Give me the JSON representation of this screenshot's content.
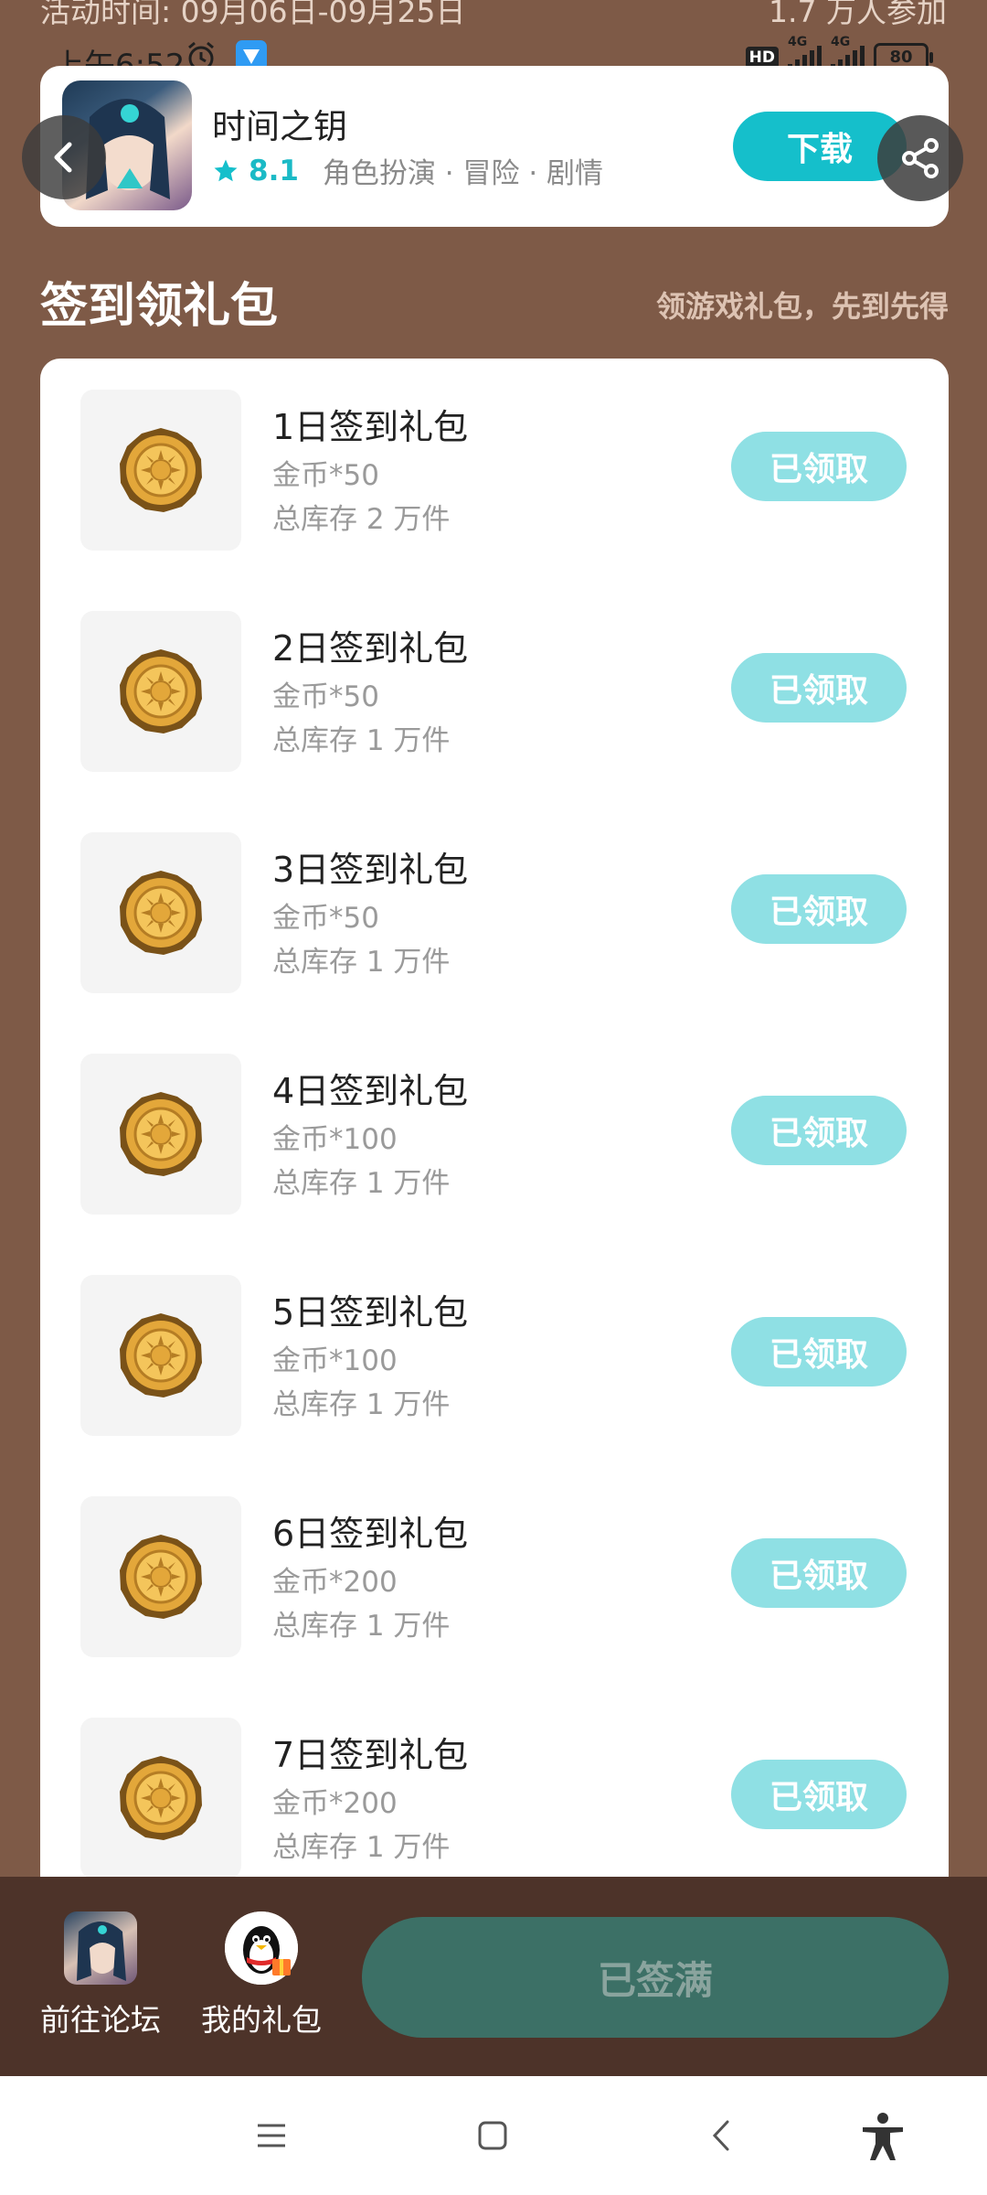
{
  "top": {
    "activity_time": "活动时间: 09月06日-09月25日",
    "participants": "1.7 万人参加"
  },
  "status_bar": {
    "time": "上午6:52",
    "hd": "HD",
    "network_1": "4G",
    "network_2": "4G",
    "battery": "80"
  },
  "game": {
    "title": "时间之钥",
    "rating": "8.1",
    "tags": "角色扮演 · 冒险 · 剧情",
    "download_label": "下载"
  },
  "section": {
    "title": "签到领礼包",
    "subtitle": "领游戏礼包，先到先得"
  },
  "gifts": [
    {
      "name": "1日签到礼包",
      "reward": "金币*50",
      "stock": "总库存 2 万件",
      "status": "已领取"
    },
    {
      "name": "2日签到礼包",
      "reward": "金币*50",
      "stock": "总库存 1 万件",
      "status": "已领取"
    },
    {
      "name": "3日签到礼包",
      "reward": "金币*50",
      "stock": "总库存 1 万件",
      "status": "已领取"
    },
    {
      "name": "4日签到礼包",
      "reward": "金币*100",
      "stock": "总库存 1 万件",
      "status": "已领取"
    },
    {
      "name": "5日签到礼包",
      "reward": "金币*100",
      "stock": "总库存 1 万件",
      "status": "已领取"
    },
    {
      "name": "6日签到礼包",
      "reward": "金币*200",
      "stock": "总库存 1 万件",
      "status": "已领取"
    },
    {
      "name": "7日签到礼包",
      "reward": "金币*200",
      "stock": "总库存 1 万件",
      "status": "已领取"
    }
  ],
  "bottom": {
    "forum_label": "前往论坛",
    "mygift_label": "我的礼包",
    "checkin_label": "已签满"
  },
  "colors": {
    "background": "#7e5a47",
    "accent": "#15bfcb",
    "claimed": "#8fe0e4",
    "bottom_bar": "#4d3329",
    "checkin_button": "#3c7066"
  },
  "icons": {
    "back": "chevron-left-icon",
    "share": "share-icon",
    "star": "star-icon",
    "coin": "gold-coin-icon"
  }
}
